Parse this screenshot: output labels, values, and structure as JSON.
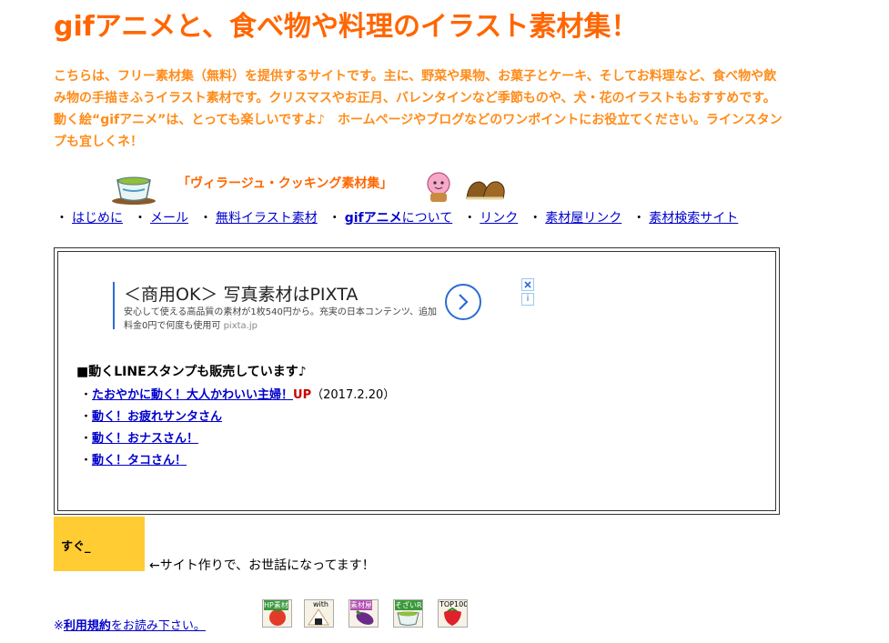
{
  "header": {
    "title": "gifアニメと、食べ物や料理のイラスト素材集！",
    "intro": "こちらは、フリー素材集（無料）を提供するサイトです。主に、野菜や果物、お菓子とケーキ、そしてお料理など、食べ物や飲み物の手描きふうイラスト素材です。クリスマスやお正月、バレンタインなど季節ものや、犬・花のイラストもおすすめです。動く絵“gifアニメ”は、とっても楽しいですよ♪　ホームページやブログなどのワンポイントにお役立てください。ラインスタンプも宜しくネ！"
  },
  "village_title": "「ヴィラージュ・クッキング素材集」",
  "nav": {
    "bullet": "・",
    "items": [
      {
        "label": "はじめに"
      },
      {
        "label": "メール"
      },
      {
        "label": "無料イラスト素材"
      },
      {
        "label_bold": "gifアニメ",
        "label": "について"
      },
      {
        "label": "リンク"
      },
      {
        "label": "素材屋リンク"
      },
      {
        "label": "素材検索サイト"
      }
    ]
  },
  "ad": {
    "title": "＜商用OK＞ 写真素材はPIXTA",
    "desc": "安心して使える高品質の素材が1枚540円から。充実の日本コンテンツ、追加料金0円で何度も使用可",
    "url": "pixta.jp",
    "info": "i"
  },
  "line": {
    "heading": "■動くLINEスタンプも販売しています♪",
    "items": [
      {
        "label": "たおやかに動く！大人かわいい主婦！",
        "badge": "UP",
        "date": "（2017.2.20）"
      },
      {
        "label": "動く！お疲れサンタさん"
      },
      {
        "label": "動く！おナスさん！"
      },
      {
        "label": "動く！タコさん！"
      }
    ]
  },
  "sugu": "すぐ_",
  "thanks": "←サイト作りで、お世話になってます！",
  "rules": {
    "prefix": "※",
    "bold": "利用規約",
    "rest": "をお読み下さい。"
  },
  "banners": [
    {
      "label": "HP素材"
    },
    {
      "label": "with"
    },
    {
      "label": "素材屋"
    },
    {
      "label": "そざいR"
    },
    {
      "label": "TOP100"
    }
  ],
  "colors": {
    "title": "#ff6600",
    "intro": "#ff8c1a",
    "link": "#0000cc",
    "up_badge": "#cc0000",
    "yellow_box": "#ffcc33",
    "ad_accent": "#2b6cd2"
  }
}
